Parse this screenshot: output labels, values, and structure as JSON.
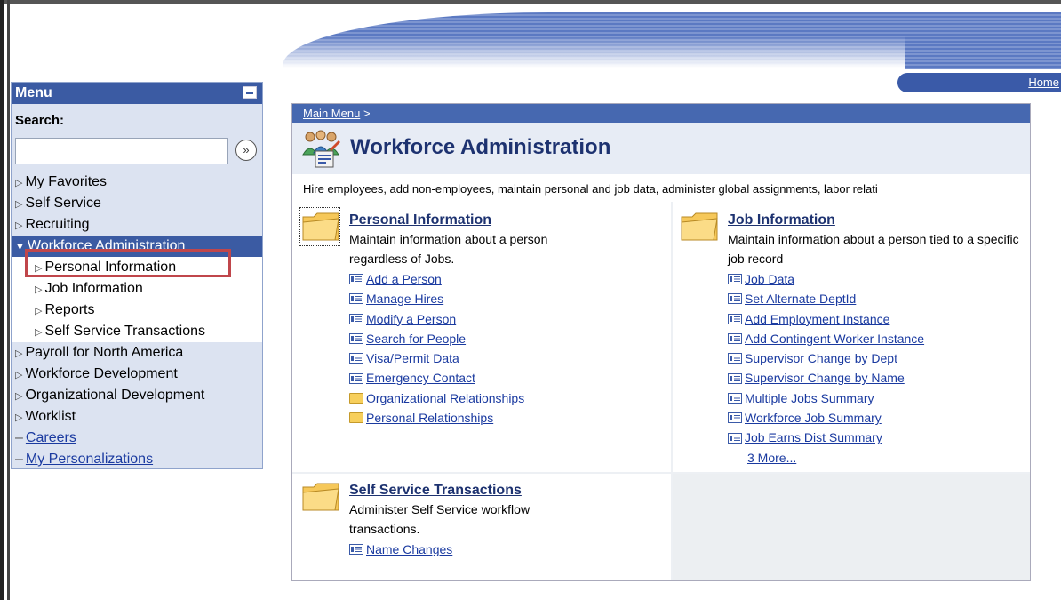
{
  "header": {
    "home_label": "Home"
  },
  "menu": {
    "title": "Menu",
    "search_label": "Search:",
    "search_value": "",
    "go_label": "»",
    "items": [
      {
        "label": "My Favorites",
        "kind": "collapsed"
      },
      {
        "label": "Self Service",
        "kind": "collapsed"
      },
      {
        "label": "Recruiting",
        "kind": "collapsed"
      },
      {
        "label": "Workforce Administration",
        "kind": "expanded"
      },
      {
        "label": "Personal Information",
        "kind": "sub"
      },
      {
        "label": "Job Information",
        "kind": "sub"
      },
      {
        "label": "Reports",
        "kind": "sub"
      },
      {
        "label": "Self Service Transactions",
        "kind": "sub"
      },
      {
        "label": "Payroll for North America",
        "kind": "collapsed"
      },
      {
        "label": "Workforce Development",
        "kind": "collapsed"
      },
      {
        "label": "Organizational Development",
        "kind": "collapsed"
      },
      {
        "label": "Worklist",
        "kind": "collapsed"
      },
      {
        "label": "Careers",
        "kind": "link"
      },
      {
        "label": "My Personalizations",
        "kind": "link"
      }
    ]
  },
  "main": {
    "breadcrumb": "Main Menu",
    "breadcrumb_sep": ">",
    "title": "Workforce Administration",
    "description": "Hire employees, add non-employees, maintain personal and job data, administer global assignments, labor relati",
    "sections": {
      "personal": {
        "title": "Personal Information",
        "description": "Maintain information about a person regardless of Jobs.",
        "links": [
          {
            "label": "Add a Person",
            "icon": "page"
          },
          {
            "label": "Manage Hires",
            "icon": "page"
          },
          {
            "label": "Modify a Person",
            "icon": "page"
          },
          {
            "label": "Search for People",
            "icon": "page"
          },
          {
            "label": "Visa/Permit Data",
            "icon": "page"
          },
          {
            "label": "Emergency Contact",
            "icon": "page"
          },
          {
            "label": "Organizational Relationships",
            "icon": "folder"
          },
          {
            "label": "Personal Relationships",
            "icon": "folder"
          }
        ]
      },
      "job": {
        "title": "Job Information",
        "description": "Maintain information about a person tied to a specific job record",
        "links": [
          {
            "label": "Job Data",
            "icon": "page"
          },
          {
            "label": "Set Alternate DeptId",
            "icon": "page"
          },
          {
            "label": "Add Employment Instance",
            "icon": "page"
          },
          {
            "label": "Add Contingent Worker Instance",
            "icon": "page"
          },
          {
            "label": "Supervisor Change by Dept",
            "icon": "page"
          },
          {
            "label": "Supervisor Change by Name",
            "icon": "page"
          },
          {
            "label": "Multiple Jobs Summary",
            "icon": "page"
          },
          {
            "label": "Workforce Job Summary",
            "icon": "page"
          },
          {
            "label": "Job Earns Dist Summary",
            "icon": "page"
          }
        ],
        "more": "3 More..."
      },
      "selfservice": {
        "title": "Self Service Transactions",
        "description": "Administer Self Service workflow transactions.",
        "links": [
          {
            "label": "Name Changes",
            "icon": "page"
          }
        ]
      }
    }
  }
}
